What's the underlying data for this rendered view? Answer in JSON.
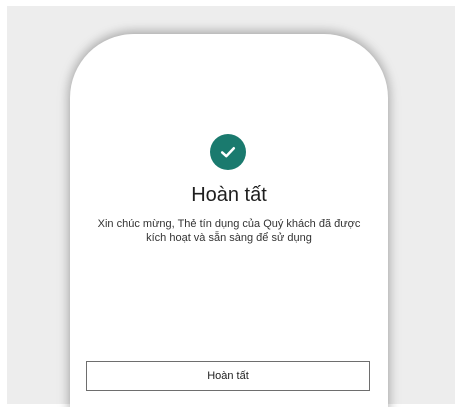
{
  "success": {
    "icon": "check-circle-icon",
    "accent_color": "#1a7a6e"
  },
  "title": "Hoàn tất",
  "message": "Xin chúc mừng, Thẻ tín dụng của Quý khách đã được kích hoạt và sẵn sàng để sử dụng",
  "button": {
    "label": "Hoàn tất"
  }
}
